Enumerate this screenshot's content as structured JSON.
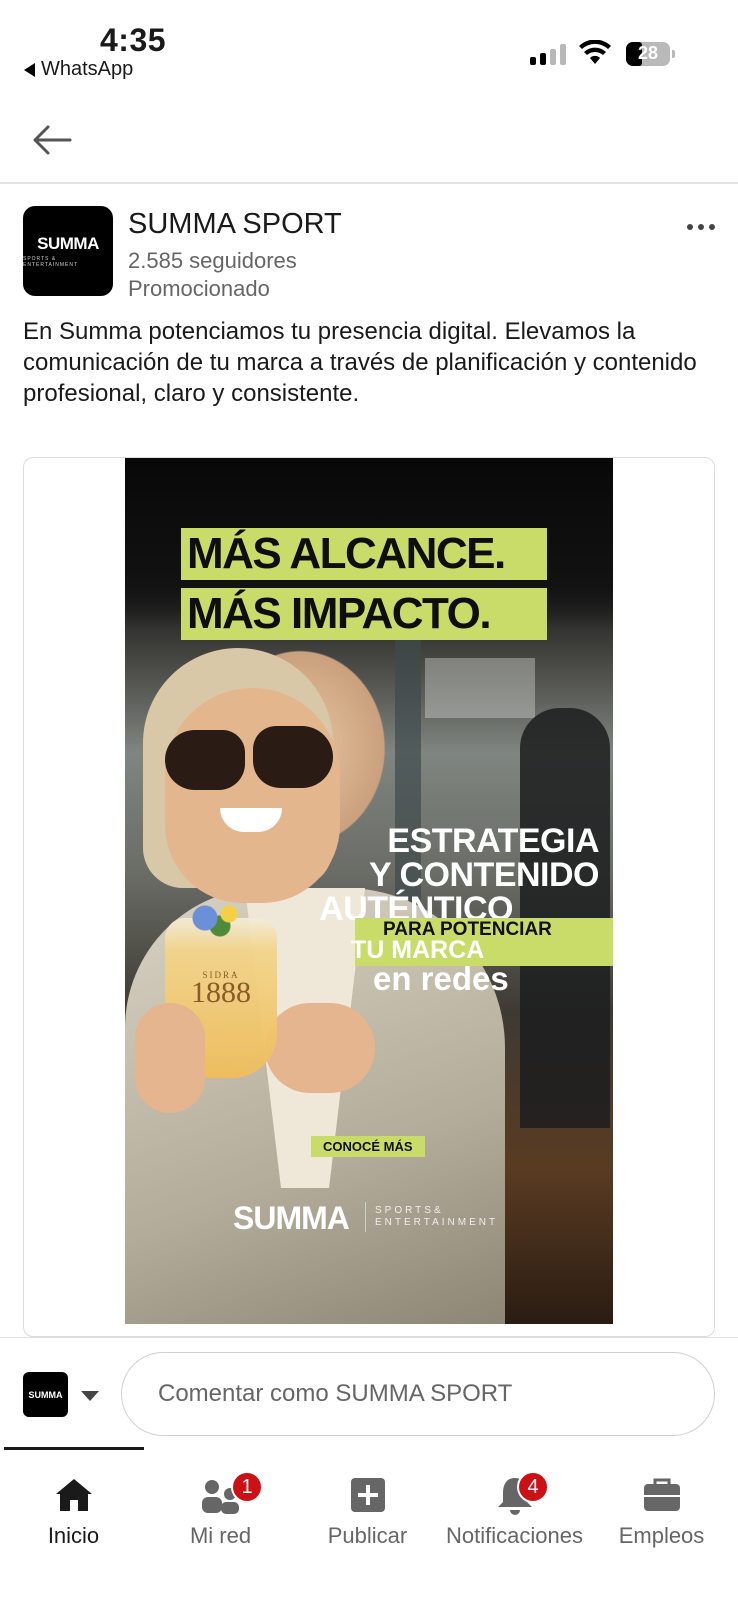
{
  "status_bar": {
    "time": "4:35",
    "back_app": "WhatsApp",
    "battery": "28"
  },
  "post": {
    "author": "SUMMA SPORT",
    "avatar_text": "SUMMA",
    "avatar_sub": "SPORTS & ENTERTAINMENT",
    "followers": "2.585 seguidores",
    "promoted": "Promocionado",
    "body": "En Summa potenciamos tu presencia digital. Elevamos la comunicación de tu marca a través de planificación y contenido profesional, claro y consistente."
  },
  "ad": {
    "headline_1": "MÁS ALCANCE.",
    "headline_2": "MÁS IMPACTO.",
    "line_1": "ESTRATEGIA",
    "line_2": "Y CONTENIDO",
    "line_3": "AUTÉNTICO",
    "line_4": "PARA POTENCIAR",
    "line_5": "TU MARCA",
    "line_6": "en redes",
    "cta": "CONOCÉ MÁS",
    "glass_brand": "SIDRA",
    "glass_year": "1888",
    "brand": "SUMMA",
    "brand_sub_1": "SPORTS&",
    "brand_sub_2": "ENTERTAINMENT",
    "accent_color": "#c9dc6a"
  },
  "comment": {
    "placeholder": "Comentar como SUMMA SPORT"
  },
  "tabs": [
    {
      "label": "Inicio",
      "icon": "home-icon",
      "badge": ""
    },
    {
      "label": "Mi red",
      "icon": "network-icon",
      "badge": "1"
    },
    {
      "label": "Publicar",
      "icon": "post-icon",
      "badge": ""
    },
    {
      "label": "Notificaciones",
      "icon": "bell-icon",
      "badge": "4"
    },
    {
      "label": "Empleos",
      "icon": "briefcase-icon",
      "badge": ""
    }
  ]
}
